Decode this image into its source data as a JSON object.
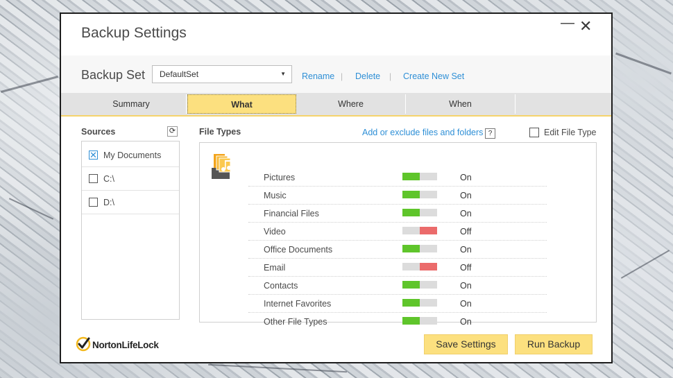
{
  "window": {
    "title": "Backup Settings"
  },
  "backup_set": {
    "label": "Backup Set",
    "selected": "DefaultSet",
    "rename": "Rename",
    "delete": "Delete",
    "create_new": "Create New Set"
  },
  "tabs": [
    {
      "label": "Summary"
    },
    {
      "label": "What",
      "active": true
    },
    {
      "label": "Where"
    },
    {
      "label": "When"
    }
  ],
  "sources": {
    "heading": "Sources",
    "items": [
      {
        "label": "My Documents",
        "checked": true
      },
      {
        "label": "C:\\",
        "checked": false
      },
      {
        "label": "D:\\",
        "checked": false
      }
    ]
  },
  "file_types": {
    "heading": "File Types",
    "add_exclude_link": "Add or exclude files and folders",
    "help": "?",
    "edit_label": "Edit File Type",
    "items": [
      {
        "name": "Pictures",
        "state": "On"
      },
      {
        "name": "Music",
        "state": "On"
      },
      {
        "name": "Financial Files",
        "state": "On"
      },
      {
        "name": "Video",
        "state": "Off"
      },
      {
        "name": "Office Documents",
        "state": "On"
      },
      {
        "name": "Email",
        "state": "Off"
      },
      {
        "name": "Contacts",
        "state": "On"
      },
      {
        "name": "Internet Favorites",
        "state": "On"
      },
      {
        "name": "Other File Types",
        "state": "On"
      }
    ]
  },
  "footer": {
    "brand": "NortonLifeLock",
    "save_settings": "Save Settings",
    "run_backup": "Run Backup"
  },
  "colors": {
    "accent_yellow": "#fce07f",
    "link_blue": "#2e8fd6",
    "toggle_on": "#5fc52b",
    "toggle_off": "#eb6b6b"
  },
  "icons": {
    "minimize": "minimize-icon",
    "close": "close-icon",
    "dropdown": "chevron-down-icon",
    "refresh": "refresh-icon",
    "file_types": "file-types-icon",
    "logo": "norton-check-icon"
  }
}
